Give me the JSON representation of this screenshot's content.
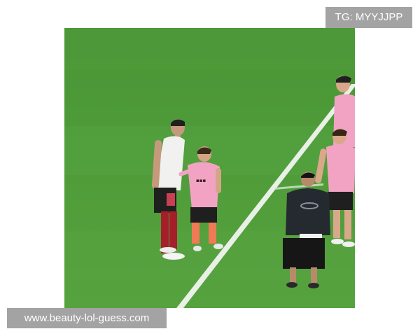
{
  "watermark_top": "TG: MYYJJPP",
  "watermark_bottom": "www.beauty-lol-guess.com",
  "colors": {
    "pitch": "#4f9a3a",
    "pitch_stripe": "#5aa545",
    "jersey_pink": "#f2a3c4",
    "shorts_dark": "#1d1d1d",
    "background": "#ffffff",
    "watermark_bg": "#a3a3a3"
  }
}
